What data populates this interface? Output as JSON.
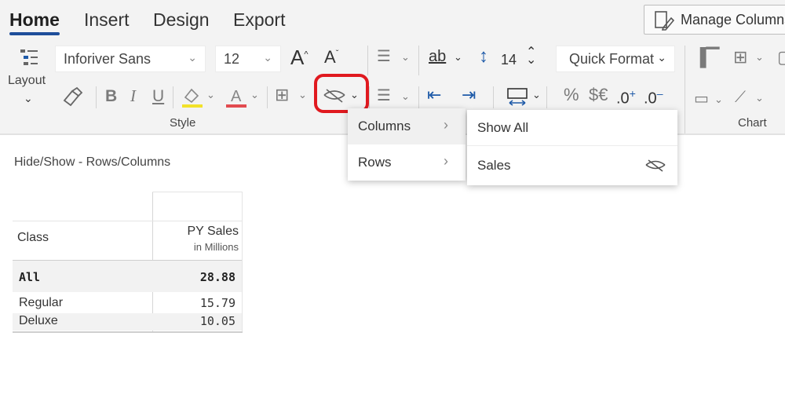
{
  "tabs": [
    "Home",
    "Insert",
    "Design",
    "Export"
  ],
  "manage_columns": "Manage Columns",
  "ribbon": {
    "layout_label": "Layout",
    "font_name": "Inforiver Sans",
    "font_size": "12",
    "spacing_value": "14",
    "quick_format": "Quick Format",
    "style_caption": "Style",
    "chart_caption": "Chart",
    "bold": "B",
    "italic": "I",
    "underline": "U",
    "percent": "%",
    "currency": "$€",
    "inc_decimal": ".0",
    "dec_decimal": ".0",
    "text_label": "ab"
  },
  "menu": {
    "level1": [
      {
        "label": "Columns"
      },
      {
        "label": "Rows"
      }
    ],
    "level2": [
      {
        "label": "Show All"
      },
      {
        "label": "Sales"
      }
    ]
  },
  "section_title": "Hide/Show - Rows/Columns",
  "table": {
    "row_header": "Class",
    "column_header": "PY Sales",
    "column_subheader": "in Millions",
    "rows": [
      {
        "label": "All",
        "value": "28.88",
        "bold": true
      },
      {
        "label": "Regular",
        "value": "15.79"
      },
      {
        "label": "Deluxe",
        "value": "10.05"
      }
    ]
  },
  "colors": {
    "accent": "#1e4e9a",
    "highlight_red": "#e0191f",
    "fill_yellow": "#f2e22a",
    "font_red": "#e24b50",
    "ribbon_bg": "#f3f3f3"
  }
}
